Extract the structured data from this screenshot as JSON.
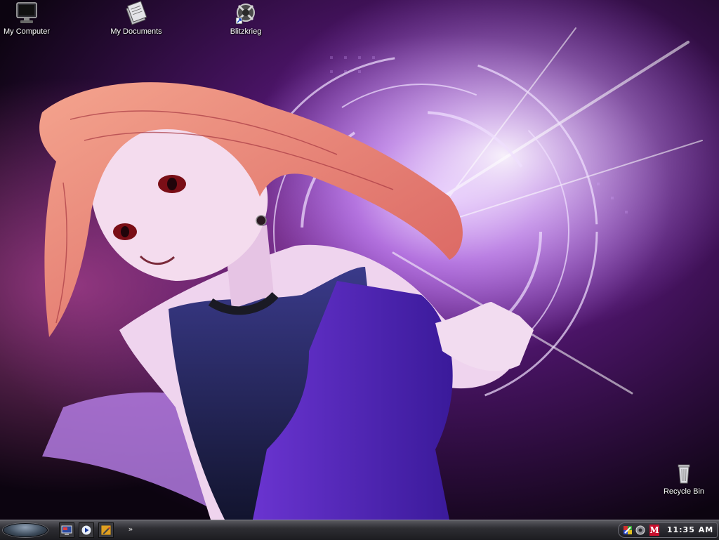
{
  "desktop": {
    "icons": [
      {
        "label": "My Computer",
        "icon": "monitor-icon"
      },
      {
        "label": "My Documents",
        "icon": "documents-icon"
      },
      {
        "label": "Blitzkrieg",
        "icon": "game-shortcut-icon"
      },
      {
        "label": "Recycle Bin",
        "icon": "trash-can-icon"
      }
    ],
    "wallpaper": {
      "subject": "anime-girl-wallpaper",
      "accent": "#7a2ea8",
      "hair": "#e58a7c"
    }
  },
  "taskbar": {
    "quick_launch": [
      {
        "icon": "show-desktop-icon"
      },
      {
        "icon": "media-player-icon"
      },
      {
        "icon": "pencil-icon"
      }
    ],
    "overflow_label": "»",
    "tray": {
      "icons": [
        "security-shield-icon",
        "speaker-icon"
      ],
      "m_label": "M",
      "m_color": "#c8102e",
      "clock": "11:35 AM"
    }
  },
  "colors": {
    "taskbar_top": "#5a5a60",
    "taskbar_bottom": "#1c1c20"
  }
}
